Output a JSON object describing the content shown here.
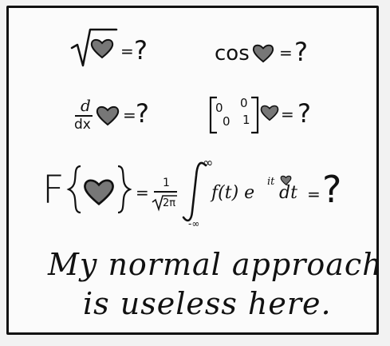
{
  "expressions": {
    "sqrt_heart": {
      "equals": "=",
      "question": "?"
    },
    "cos_heart": {
      "func": "cos",
      "equals": "=",
      "question": "?"
    },
    "derivative_heart": {
      "d_numerator": "d",
      "dx_denominator": "dx",
      "equals": "=",
      "question": "?"
    },
    "matrix_heart": {
      "m11": "0",
      "m12": "0",
      "m21": "0",
      "m22": "1",
      "equals": "=",
      "question": "?"
    },
    "fourier_heart": {
      "operator": "F",
      "equals1": "=",
      "frac_numerator": "1",
      "frac_denominator": "2π",
      "upper_limit": "∞",
      "lower_limit": "-∞",
      "integrand": "f(t) e",
      "exponent": "it",
      "dt": "dt",
      "equals2": "=",
      "question": "?"
    }
  },
  "caption": {
    "line1": "My normal approach",
    "line2": "is useless here."
  },
  "colors": {
    "ink": "#111111",
    "paper": "#fbfbfb",
    "background": "#f2f2f2"
  },
  "icons": [
    "heart-icon"
  ]
}
